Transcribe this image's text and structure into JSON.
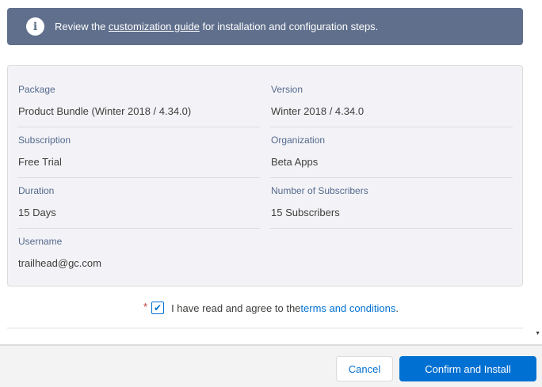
{
  "banner": {
    "icon": "info-icon",
    "text_before": "Review the ",
    "link_text": "customization guide",
    "text_after": " for installation and configuration steps."
  },
  "details": {
    "package_label": "Package",
    "package_value": "Product Bundle (Winter 2018 / 4.34.0)",
    "version_label": "Version",
    "version_value": "Winter 2018 / 4.34.0",
    "subscription_label": "Subscription",
    "subscription_value": "Free Trial",
    "organization_label": "Organization",
    "organization_value": "Beta Apps",
    "duration_label": "Duration",
    "duration_value": "15 Days",
    "subscribers_label": "Number of Subscribers",
    "subscribers_value": "15 Subscribers",
    "username_label": "Username",
    "username_value": "trailhead@gc.com"
  },
  "agreement": {
    "required_mark": "*",
    "checked": true,
    "text_before": "I have read and agree to the ",
    "link_text": "terms and conditions",
    "text_after": "."
  },
  "footer": {
    "cancel_label": "Cancel",
    "confirm_label": "Confirm and Install"
  },
  "colors": {
    "banner_bg": "#5f6f8c",
    "card_bg": "#f3f3f7",
    "brand_blue": "#0070d2",
    "required_red": "#c23934"
  }
}
